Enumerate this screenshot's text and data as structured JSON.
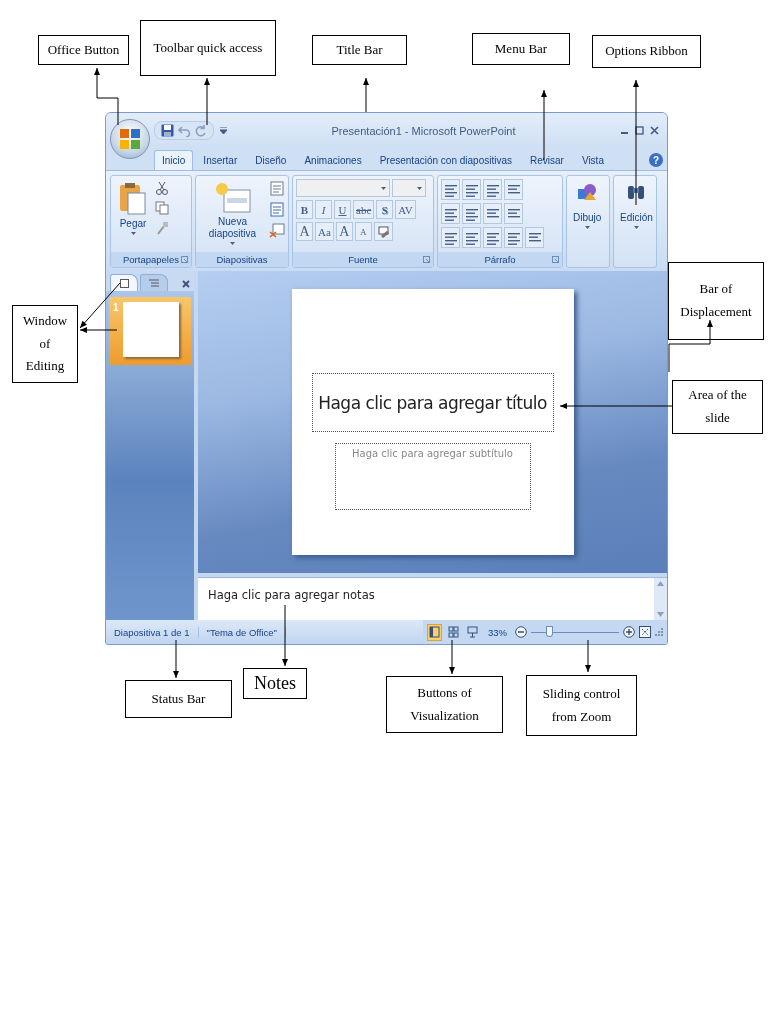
{
  "callouts": [
    {
      "text": "Office Button"
    },
    {
      "text": "Toolbar quick access"
    },
    {
      "text": "Title Bar"
    },
    {
      "text": "Menu Bar"
    },
    {
      "text": "Options Ribbon"
    },
    {
      "text": "Window of Editing"
    },
    {
      "text": "Bar of Displacement"
    },
    {
      "text": "Area of the slide"
    },
    {
      "text": "Status Bar"
    },
    {
      "text": "Notes"
    },
    {
      "text": "Buttons of Visualization"
    },
    {
      "text": "Sliding control from Zoom"
    }
  ],
  "window": {
    "title": "Presentación1 - Microsoft PowerPoint",
    "help": "?"
  },
  "tabs": [
    {
      "label": "Inicio",
      "selected": true
    },
    {
      "label": "Insertar",
      "selected": false
    },
    {
      "label": "Diseño",
      "selected": false
    },
    {
      "label": "Animaciones",
      "selected": false
    },
    {
      "label": "Presentación con diapositivas",
      "selected": false
    },
    {
      "label": "Revisar",
      "selected": false
    },
    {
      "label": "Vista",
      "selected": false
    }
  ],
  "ribbon": [
    {
      "kind": "clipboard",
      "label": "Portapapeles",
      "launcher": true,
      "button": {
        "label": "Pegar",
        "dropdown": true
      }
    },
    {
      "kind": "slides",
      "label": "Diapositivas",
      "launcher": false,
      "button": {
        "label": "Nueva diapositiva",
        "dropdown": true
      }
    },
    {
      "kind": "font",
      "label": "Fuente",
      "launcher": true,
      "format_buttons": [
        {
          "text": "B",
          "kind": "bold"
        },
        {
          "text": "I",
          "kind": "italic"
        },
        {
          "text": "U",
          "kind": "underline"
        },
        {
          "text": "abc",
          "kind": "strike"
        },
        {
          "text": "S",
          "kind": "shadow"
        },
        {
          "text": "AV",
          "kind": "plain"
        }
      ],
      "size_buttons": [
        {
          "text": "A",
          "kind": "large"
        },
        {
          "text": "Aa",
          "kind": "plain"
        },
        {
          "text": "A",
          "kind": "large"
        },
        {
          "text": "A",
          "kind": "small"
        }
      ]
    },
    {
      "kind": "paragraph",
      "label": "Párrafo",
      "launcher": true
    },
    {
      "kind": "drawing",
      "button": {
        "label": "Dibujo",
        "dropdown": true
      }
    },
    {
      "kind": "editing",
      "button": {
        "label": "Edición",
        "dropdown": true
      }
    }
  ],
  "slide_panel": {
    "tabs": [
      {
        "kind": "slides",
        "selected": true
      },
      {
        "kind": "outline",
        "selected": false
      }
    ],
    "thumbnails": [
      {
        "number": "1",
        "selected": true
      }
    ]
  },
  "slide": {
    "title_prompt": "Haga clic para agregar título",
    "subtitle_prompt": "Haga clic para agregar subtítulo"
  },
  "notes": {
    "prompt": "Haga clic para agregar notas"
  },
  "status_bar": {
    "slide": "Diapositiva 1 de 1",
    "theme": "\"Tema de Office\"",
    "views": [
      {
        "kind": "normal",
        "selected": true
      },
      {
        "kind": "sorter",
        "selected": false
      },
      {
        "kind": "show",
        "selected": false
      }
    ],
    "zoom": {
      "reading": "33%",
      "level": 0.2
    }
  }
}
